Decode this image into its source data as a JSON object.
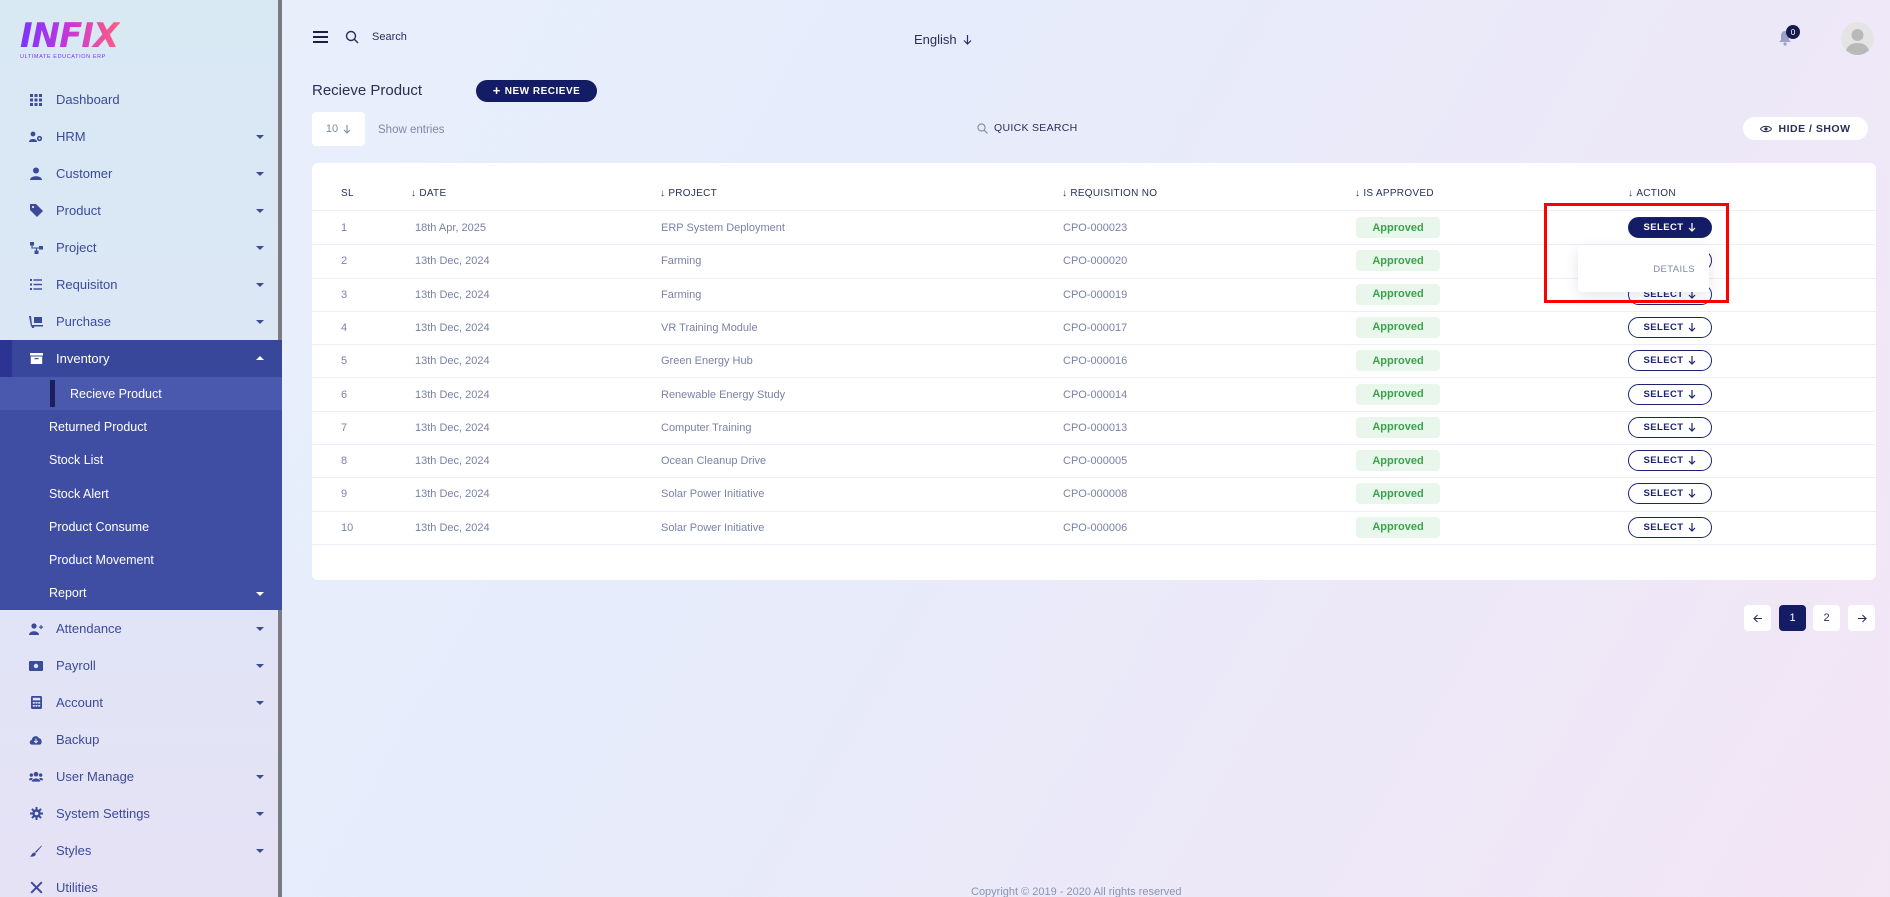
{
  "brand": {
    "logo_text": "INFIX",
    "logo_sub": "ULTIMATE EDUCATION ERP"
  },
  "sidebar": {
    "items_top": [
      {
        "label": "Dashboard",
        "icon": "grid-icon",
        "caret": false
      },
      {
        "label": "HRM",
        "icon": "users-cog-icon",
        "caret": true
      },
      {
        "label": "Customer",
        "icon": "user-icon",
        "caret": true
      },
      {
        "label": "Product",
        "icon": "tags-icon",
        "caret": true
      },
      {
        "label": "Project",
        "icon": "sitemap-icon",
        "caret": true
      },
      {
        "label": "Requisiton",
        "icon": "list-icon",
        "caret": true
      },
      {
        "label": "Purchase",
        "icon": "dolly-icon",
        "caret": true
      }
    ],
    "inventory": {
      "label": "Inventory",
      "subitems": [
        {
          "label": "Recieve Product",
          "active": true
        },
        {
          "label": "Returned Product"
        },
        {
          "label": "Stock List"
        },
        {
          "label": "Stock Alert"
        },
        {
          "label": "Product Consume"
        },
        {
          "label": "Product Movement"
        },
        {
          "label": "Report",
          "caret": true
        }
      ]
    },
    "items_bottom": [
      {
        "label": "Attendance",
        "icon": "user-plus-icon",
        "caret": true
      },
      {
        "label": "Payroll",
        "icon": "money-icon",
        "caret": true
      },
      {
        "label": "Account",
        "icon": "calculator-icon",
        "caret": true
      },
      {
        "label": "Backup",
        "icon": "cloud-download-icon",
        "caret": false
      },
      {
        "label": "User Manage",
        "icon": "users-icon",
        "caret": true
      },
      {
        "label": "System Settings",
        "icon": "gear-icon",
        "caret": true
      },
      {
        "label": "Styles",
        "icon": "brush-icon",
        "caret": true
      },
      {
        "label": "Utilities",
        "icon": "tools-icon",
        "caret": false
      }
    ]
  },
  "topbar": {
    "search_placeholder": "Search",
    "language": "English",
    "notification_count": "0"
  },
  "page": {
    "title": "Recieve Product",
    "new_button": "NEW RECIEVE",
    "entries_value": "10",
    "entries_label": "Show entries",
    "quick_search": "QUICK SEARCH",
    "hide_show": "HIDE / SHOW"
  },
  "table": {
    "headers": {
      "sl": "SL",
      "date": "DATE",
      "project": "PROJECT",
      "requisition": "REQUISITION NO",
      "approved": "IS APPROVED",
      "action": "ACTION"
    },
    "select_label": "SELECT",
    "rows": [
      {
        "sl": "1",
        "date": "18th Apr, 2025",
        "project": "ERP System Deployment",
        "req": "CPO-000023",
        "status": "Approved"
      },
      {
        "sl": "2",
        "date": "13th Dec, 2024",
        "project": "Farming",
        "req": "CPO-000020",
        "status": "Approved"
      },
      {
        "sl": "3",
        "date": "13th Dec, 2024",
        "project": "Farming",
        "req": "CPO-000019",
        "status": "Approved"
      },
      {
        "sl": "4",
        "date": "13th Dec, 2024",
        "project": "VR Training Module",
        "req": "CPO-000017",
        "status": "Approved"
      },
      {
        "sl": "5",
        "date": "13th Dec, 2024",
        "project": "Green Energy Hub",
        "req": "CPO-000016",
        "status": "Approved"
      },
      {
        "sl": "6",
        "date": "13th Dec, 2024",
        "project": "Renewable Energy Study",
        "req": "CPO-000014",
        "status": "Approved"
      },
      {
        "sl": "7",
        "date": "13th Dec, 2024",
        "project": "Computer Training",
        "req": "CPO-000013",
        "status": "Approved"
      },
      {
        "sl": "8",
        "date": "13th Dec, 2024",
        "project": "Ocean Cleanup Drive",
        "req": "CPO-000005",
        "status": "Approved"
      },
      {
        "sl": "9",
        "date": "13th Dec, 2024",
        "project": "Solar Power Initiative",
        "req": "CPO-000008",
        "status": "Approved"
      },
      {
        "sl": "10",
        "date": "13th Dec, 2024",
        "project": "Solar Power Initiative",
        "req": "CPO-000006",
        "status": "Approved"
      }
    ],
    "dropdown_item": "DETAILS"
  },
  "pagination": {
    "pages": [
      "1",
      "2"
    ],
    "current": "1"
  },
  "footer": "Copyright © 2019 - 2020 All rights reserved",
  "colors": {
    "primary": "#141c66",
    "sidebar_active": "#3f4ea3",
    "approved_text": "#3aa24b",
    "highlight": "#ff0000"
  }
}
